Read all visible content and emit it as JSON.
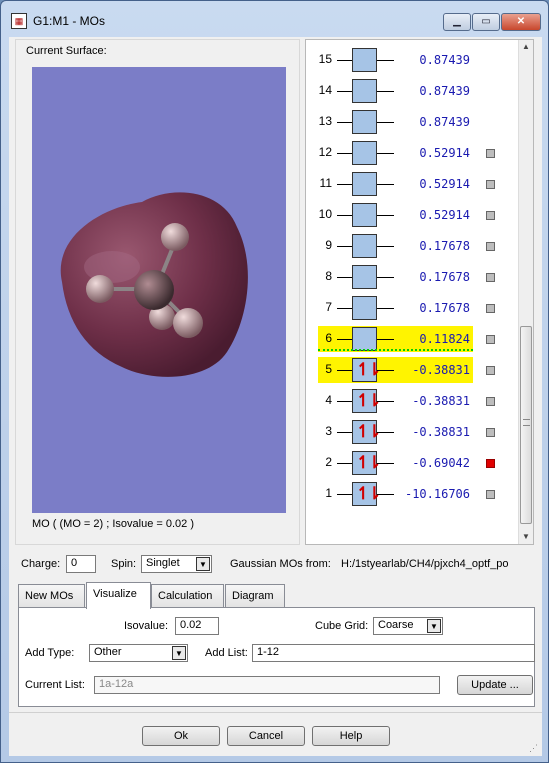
{
  "window": {
    "title": "G1:M1 - MOs",
    "app_icon": "gaussview-icon"
  },
  "surface": {
    "label": "Current Surface:",
    "caption": "MO ( (MO = 2) ; Isovalue = 0.02 )",
    "background": "#7b7dc7"
  },
  "orbitals": [
    {
      "num": "15",
      "energy": "0.87439",
      "occupied": false,
      "visualized": null,
      "highlight": false
    },
    {
      "num": "14",
      "energy": "0.87439",
      "occupied": false,
      "visualized": null,
      "highlight": false
    },
    {
      "num": "13",
      "energy": "0.87439",
      "occupied": false,
      "visualized": null,
      "highlight": false
    },
    {
      "num": "12",
      "energy": "0.52914",
      "occupied": false,
      "visualized": false,
      "highlight": false
    },
    {
      "num": "11",
      "energy": "0.52914",
      "occupied": false,
      "visualized": false,
      "highlight": false
    },
    {
      "num": "10",
      "energy": "0.52914",
      "occupied": false,
      "visualized": false,
      "highlight": false
    },
    {
      "num": "9",
      "energy": "0.17678",
      "occupied": false,
      "visualized": false,
      "highlight": false
    },
    {
      "num": "8",
      "energy": "0.17678",
      "occupied": false,
      "visualized": false,
      "highlight": false
    },
    {
      "num": "7",
      "energy": "0.17678",
      "occupied": false,
      "visualized": false,
      "highlight": false
    },
    {
      "num": "6",
      "energy": "0.11824",
      "occupied": false,
      "visualized": false,
      "highlight": true
    },
    {
      "num": "5",
      "energy": "-0.38831",
      "occupied": true,
      "visualized": false,
      "highlight": true
    },
    {
      "num": "4",
      "energy": "-0.38831",
      "occupied": true,
      "visualized": false,
      "highlight": false
    },
    {
      "num": "3",
      "energy": "-0.38831",
      "occupied": true,
      "visualized": false,
      "highlight": false
    },
    {
      "num": "2",
      "energy": "-0.69042",
      "occupied": true,
      "visualized": true,
      "highlight": false
    },
    {
      "num": "1",
      "energy": "-10.16706",
      "occupied": true,
      "visualized": false,
      "highlight": false
    }
  ],
  "occupied_glyph": "↿⇂",
  "charge": {
    "label": "Charge:",
    "value": "0"
  },
  "spin": {
    "label": "Spin:",
    "value": "Singlet"
  },
  "source": {
    "label": "Gaussian MOs from:",
    "path": "H:/1styearlab/CH4/pjxch4_optf_po"
  },
  "tabs": [
    {
      "label": "New MOs",
      "active": false
    },
    {
      "label": "Visualize",
      "active": true
    },
    {
      "label": "Calculation",
      "active": false
    },
    {
      "label": "Diagram",
      "active": false
    }
  ],
  "visualize": {
    "isovalue_label": "Isovalue:",
    "isovalue": "0.02",
    "cube_grid_label": "Cube Grid:",
    "cube_grid": "Coarse",
    "add_type_label": "Add Type:",
    "add_type": "Other",
    "add_list_label": "Add List:",
    "add_list": "1-12",
    "current_list_label": "Current List:",
    "current_list": "1a-12a",
    "update_button": "Update ..."
  },
  "buttons": {
    "ok": "Ok",
    "cancel": "Cancel",
    "help": "Help"
  },
  "colors": {
    "highlight": "#fff100",
    "orbital_box": "#a6c4e6",
    "energy_text": "#1a1ab0",
    "electron": "#d00000",
    "visualized": "#e00000"
  }
}
